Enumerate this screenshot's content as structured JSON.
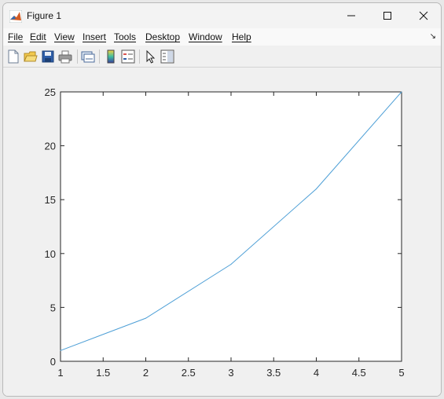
{
  "window": {
    "title": "Figure 1"
  },
  "menu": {
    "items": [
      "File",
      "Edit",
      "View",
      "Insert",
      "Tools",
      "Desktop",
      "Window",
      "Help"
    ]
  },
  "toolbar": {
    "buttons": [
      "new-figure-icon",
      "open-file-icon",
      "save-icon",
      "print-icon",
      "link-plot-icon",
      "insert-colorbar-icon",
      "insert-legend-icon",
      "edit-plot-arrow-icon",
      "property-inspector-icon"
    ]
  },
  "colors": {
    "line": "#4d9fd6",
    "axes_bg": "#ffffff",
    "figure_bg": "#f0f0f0"
  },
  "chart_data": {
    "type": "line",
    "x": [
      1,
      2,
      3,
      4,
      5
    ],
    "series": [
      {
        "values": [
          1,
          4,
          9,
          16,
          25
        ]
      }
    ],
    "xlim": [
      1,
      5
    ],
    "ylim": [
      0,
      25
    ],
    "xticks": [
      "1",
      "1.5",
      "2",
      "2.5",
      "3",
      "3.5",
      "4",
      "4.5",
      "5"
    ],
    "yticks": [
      "0",
      "5",
      "10",
      "15",
      "20",
      "25"
    ],
    "title": "",
    "xlabel": "",
    "ylabel": "",
    "grid": false
  }
}
